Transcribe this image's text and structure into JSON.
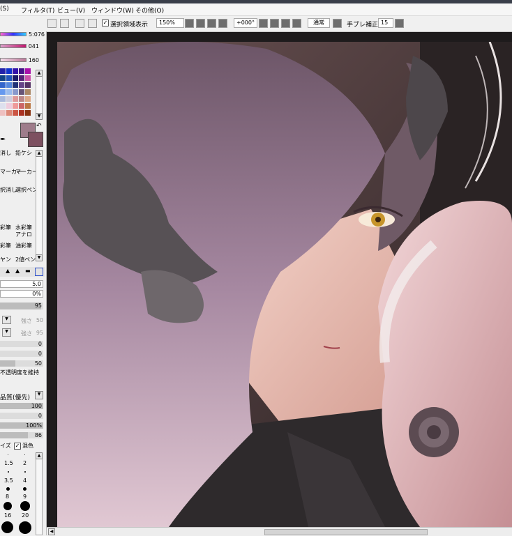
{
  "menu": {
    "items": [
      "(S)",
      "フィルタ(T)",
      "ビュー(V)",
      "ウィンドウ(W)",
      "その他(O)"
    ]
  },
  "toolbar": {
    "selection_label": "選択領域表示",
    "zoom_value": "150%",
    "rotation_value": "+000°",
    "blend_mode": "通常",
    "stabilizer_label": "手ブレ補正",
    "stabilizer_value": "15"
  },
  "color_panel": {
    "hue_value": "5:076",
    "sat_value": "041",
    "val_value": "160"
  },
  "tools": {
    "labels": [
      "消し",
      "鉛ケシ",
      "マーカー",
      "マーカー",
      "択消し",
      "選択ペン",
      "彩筆",
      "水彩筆",
      "",
      "アナロ",
      "彩筆",
      "油彩筆",
      "ヤン",
      "2値ペン"
    ]
  },
  "brush_settings": {
    "size_value": "5.0",
    "min_size_value": "0%",
    "density_value": "95",
    "field_a": "強さ",
    "field_a_value": "50",
    "field_b": "強さ",
    "field_b_value": "95",
    "v0a": "0",
    "v0b": "0",
    "v50": "50",
    "keep_opacity_label": "不透明度を維持",
    "quality_label": "品質(優先)",
    "v100": "100",
    "v0c": "0",
    "v100pct": "100%",
    "v86": "86",
    "size_label": "イズ",
    "mix_label": "混色",
    "brush_sizes": [
      "1.5",
      "2",
      "3.5",
      "4",
      "8",
      "9",
      "16",
      "20"
    ]
  },
  "colors": {
    "main": "#9e7c8b",
    "sub": "#7d5060",
    "accent": "#3355cc"
  }
}
